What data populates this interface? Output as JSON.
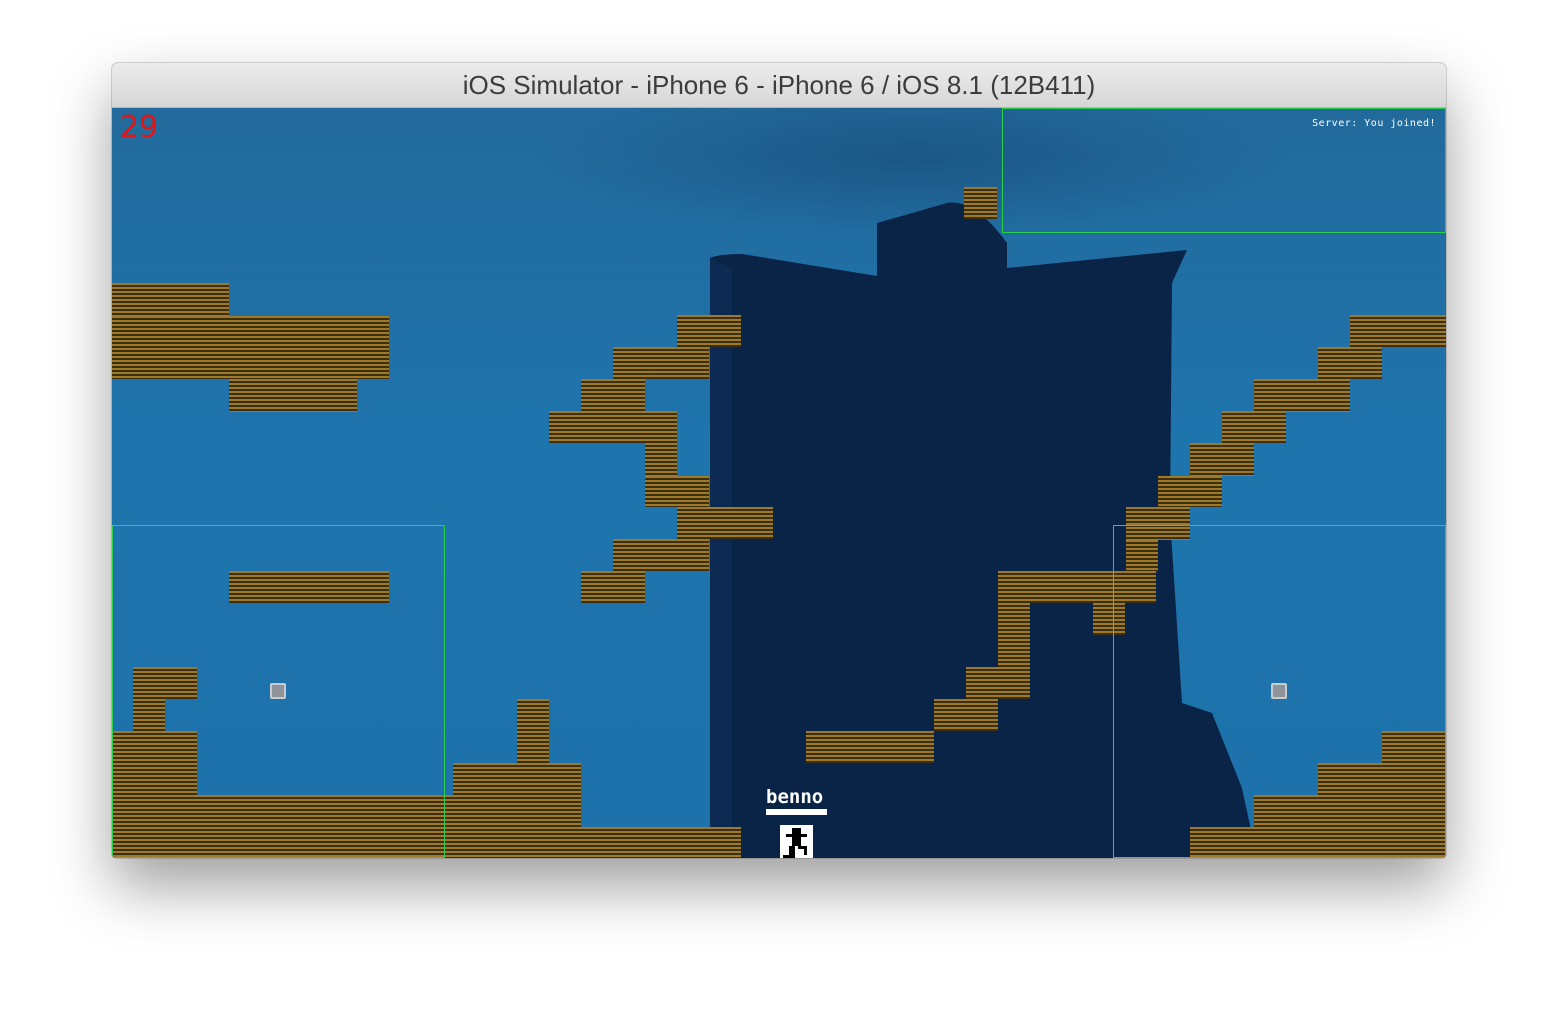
{
  "window": {
    "title": "iOS Simulator - iPhone 6 - iPhone 6 / iOS 8.1 (12B411)"
  },
  "hud": {
    "score": "29",
    "server_message": "Server: You joined!"
  },
  "player": {
    "name": "benno"
  },
  "colors": {
    "sky": "#1f6d9f",
    "silhouette": "#0a2447",
    "tile_light": "#a07a22",
    "tile_dark": "#3a2e14",
    "zone_outline": "#2ccf4a",
    "score_text": "#e01616"
  },
  "icons": {
    "player_sprite": "pixel-runner-icon",
    "left_stick": "joystick-thumb-icon",
    "right_stick": "joystick-thumb-icon"
  }
}
